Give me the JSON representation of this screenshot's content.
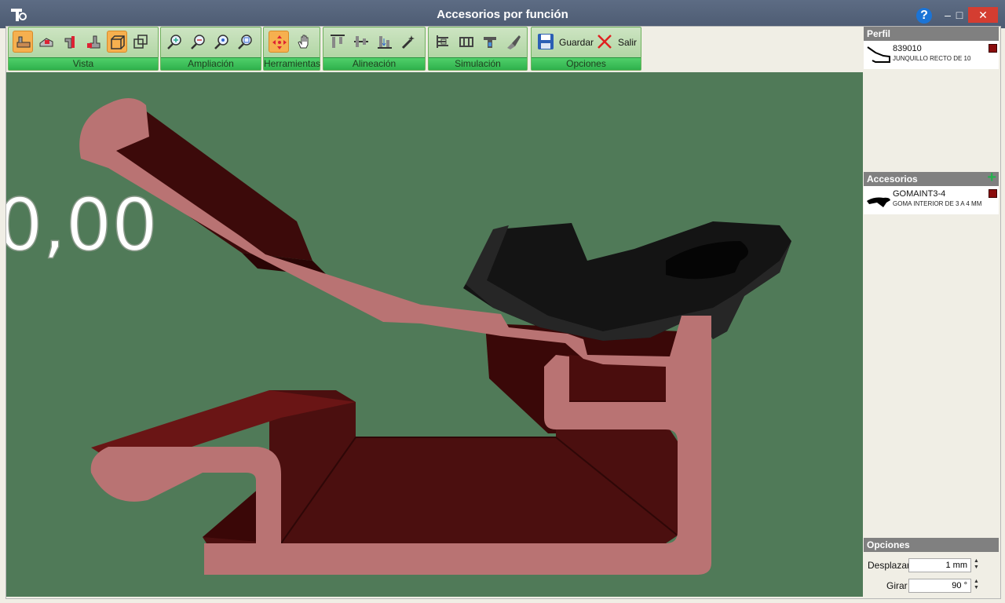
{
  "window": {
    "title": "Accesorios por función",
    "help": "?",
    "minimize": "–",
    "maximize": "□",
    "close": "✕"
  },
  "ribbon": {
    "groups": [
      {
        "label": "Vista"
      },
      {
        "label": "Ampliación"
      },
      {
        "label": "Herramientas"
      },
      {
        "label": "Alineación"
      },
      {
        "label": "Simulación"
      },
      {
        "label": "Opciones"
      }
    ],
    "save_label": "Guardar",
    "exit_label": "Salir"
  },
  "viewport": {
    "measure": "0,00"
  },
  "perfil": {
    "header": "Perfil",
    "item": {
      "code": "839010",
      "description": "JUNQUILLO RECTO DE 10",
      "color": "#8a0c0c"
    }
  },
  "accesorios": {
    "header": "Accesorios",
    "add": "+",
    "item": {
      "code": "GOMAINT3-4",
      "description": "GOMA INTERIOR DE 3 A 4 MM",
      "color": "#8a0c0c"
    }
  },
  "opciones": {
    "header": "Opciones",
    "desplazar_label": "Desplazar",
    "desplazar_value": "1 mm",
    "girar_label": "Girar",
    "girar_value": "90 °"
  }
}
